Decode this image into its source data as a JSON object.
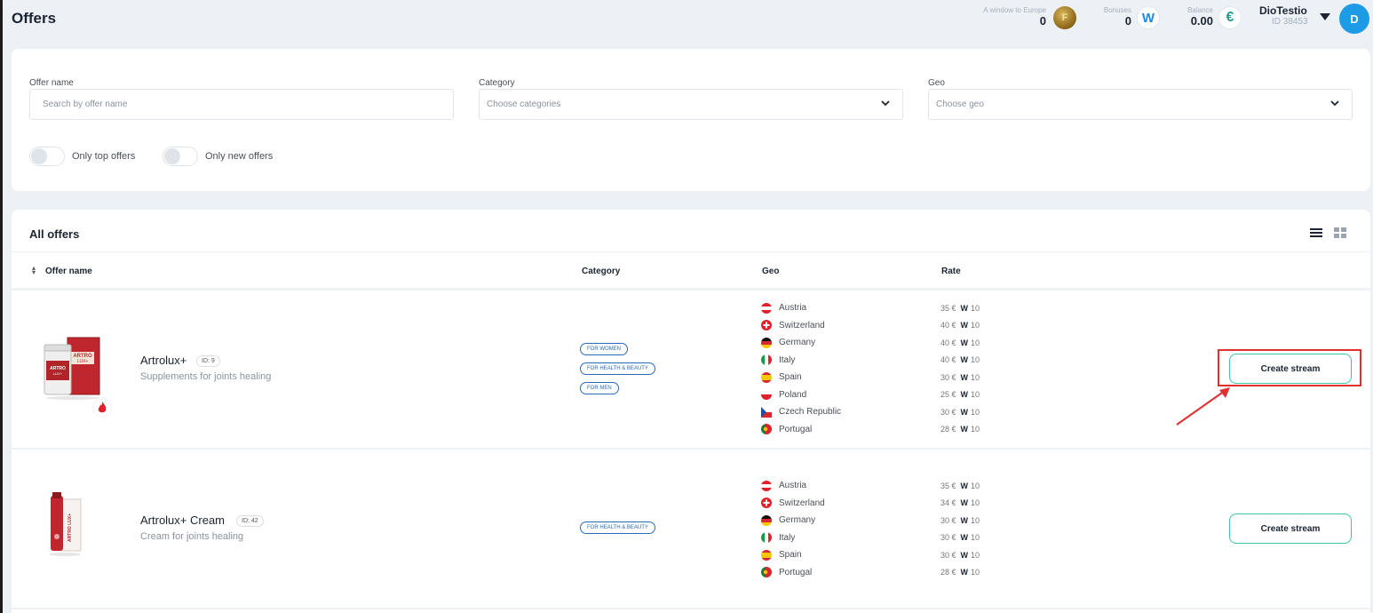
{
  "header": {
    "title": "Offers",
    "stats": [
      {
        "label": "A window to Europe",
        "value": "0",
        "icon": "gold-coin-icon"
      },
      {
        "label": "Bonuses",
        "value": "0",
        "icon": "w-coin-icon"
      },
      {
        "label": "Balance",
        "value": "0.00",
        "icon": "euro-icon"
      }
    ],
    "user": {
      "name": "DioTestio",
      "id": "ID 38453",
      "avatar_letter": "D"
    }
  },
  "filters": {
    "offer_name": {
      "label": "Offer name",
      "placeholder": "Search by offer name"
    },
    "category": {
      "label": "Category",
      "placeholder": "Choose categories"
    },
    "geo": {
      "label": "Geo",
      "placeholder": "Choose geo"
    },
    "toggles": [
      {
        "label": "Only top offers",
        "on": false
      },
      {
        "label": "Only new offers",
        "on": false
      }
    ]
  },
  "offers_table": {
    "title": "All offers",
    "columns": [
      "Offer name",
      "Category",
      "Geo",
      "Rate"
    ],
    "rows": [
      {
        "name": "Artrolux+",
        "id": "ID: 9",
        "description": "Supplements for joints healing",
        "categories": [
          "FOR WOMEN",
          "FOR HEALTH & BEAUTY",
          "FOR MEN"
        ],
        "geos": [
          {
            "country": "Austria",
            "rate": "35 €",
            "bonus": "W",
            "bonus_value": "10"
          },
          {
            "country": "Switzerland",
            "rate": "40 €",
            "bonus": "W",
            "bonus_value": "10"
          },
          {
            "country": "Germany",
            "rate": "40 €",
            "bonus": "W",
            "bonus_value": "10"
          },
          {
            "country": "Italy",
            "rate": "40 €",
            "bonus": "W",
            "bonus_value": "10"
          },
          {
            "country": "Spain",
            "rate": "30 €",
            "bonus": "W",
            "bonus_value": "10"
          },
          {
            "country": "Poland",
            "rate": "25 €",
            "bonus": "W",
            "bonus_value": "10"
          },
          {
            "country": "Czech Republic",
            "rate": "30 €",
            "bonus": "W",
            "bonus_value": "10"
          },
          {
            "country": "Portugal",
            "rate": "28 €",
            "bonus": "W",
            "bonus_value": "10"
          }
        ],
        "action": "Create stream",
        "hot": true
      },
      {
        "name": "Artrolux+ Cream",
        "id": "ID: 42",
        "description": "Cream for joints healing",
        "categories": [
          "FOR HEALTH & BEAUTY"
        ],
        "geos": [
          {
            "country": "Austria",
            "rate": "35 €",
            "bonus": "W",
            "bonus_value": "10"
          },
          {
            "country": "Switzerland",
            "rate": "34 €",
            "bonus": "W",
            "bonus_value": "10"
          },
          {
            "country": "Germany",
            "rate": "30 €",
            "bonus": "W",
            "bonus_value": "10"
          },
          {
            "country": "Italy",
            "rate": "30 €",
            "bonus": "W",
            "bonus_value": "10"
          },
          {
            "country": "Spain",
            "rate": "30 €",
            "bonus": "W",
            "bonus_value": "10"
          },
          {
            "country": "Portugal",
            "rate": "28 €",
            "bonus": "W",
            "bonus_value": "10"
          }
        ],
        "action": "Create stream",
        "hot": false
      }
    ]
  },
  "colors": {
    "accent": "#3cc4a9",
    "avatar": "#1e9be6",
    "highlight": "#e03030",
    "category": "#2a6bb8"
  }
}
